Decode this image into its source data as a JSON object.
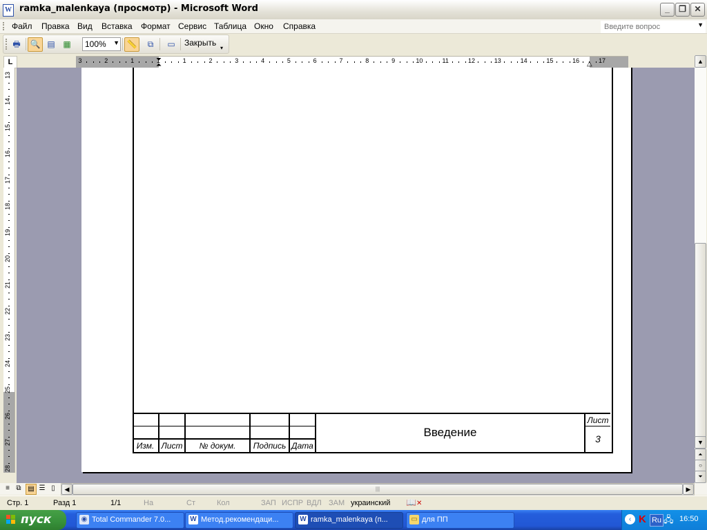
{
  "window": {
    "title": "ramka_malenkaya (просмотр) - Microsoft Word",
    "icon": "word-doc-icon",
    "controls": [
      "minimize-icon",
      "restore-icon",
      "close-icon"
    ]
  },
  "menu": {
    "items": [
      "Файл",
      "Правка",
      "Вид",
      "Вставка",
      "Формат",
      "Сервис",
      "Таблица",
      "Окно",
      "Справка"
    ],
    "help_placeholder": "Введите вопрос"
  },
  "toolbar": {
    "zoom": "100%",
    "close_label": "Закрыть"
  },
  "ruler": {
    "corner": "L",
    "h_labels": [
      "3",
      "2",
      "1",
      "1",
      "1",
      "2",
      "3",
      "4",
      "5",
      "6",
      "7",
      "8",
      "9",
      "10",
      "11",
      "12",
      "13",
      "14",
      "15",
      "16",
      "17"
    ],
    "v_labels": [
      "13",
      "14",
      "15",
      "16",
      "17",
      "18",
      "19",
      "20",
      "21",
      "22",
      "23",
      "24",
      "25",
      "26",
      "27",
      "28"
    ]
  },
  "stamp": {
    "headers": [
      "Изм.",
      "Лист",
      "№ докум.",
      "Подпись",
      "Дата"
    ],
    "title": "Введение",
    "sheet_label": "Лист",
    "sheet_number": "3"
  },
  "status": {
    "page": "Стр. 1",
    "section": "Разд 1",
    "pages": "1/1",
    "at": "На",
    "line": "Ст",
    "col": "Кол",
    "rec": "ЗАП",
    "trk": "ИСПР",
    "ext": "ВДЛ",
    "ovr": "ЗАМ",
    "language": "украинский"
  },
  "taskbar": {
    "start": "пуск",
    "tasks": [
      {
        "label": "Total Commander 7.0...",
        "icon": "total-commander-icon",
        "active": false
      },
      {
        "label": "Метод.рекомендаци...",
        "icon": "word-doc-icon",
        "active": false
      },
      {
        "label": "ramka_malenkaya (п...",
        "icon": "word-doc-icon",
        "active": true
      },
      {
        "label": "для ПП",
        "icon": "folder-icon",
        "active": false
      }
    ],
    "lang": "Ru",
    "clock": "16:50"
  },
  "colors": {
    "workspace": "#9b9bb0",
    "taskbar": "#245edc",
    "start": "#37903a",
    "active_button": "#f9d596"
  }
}
